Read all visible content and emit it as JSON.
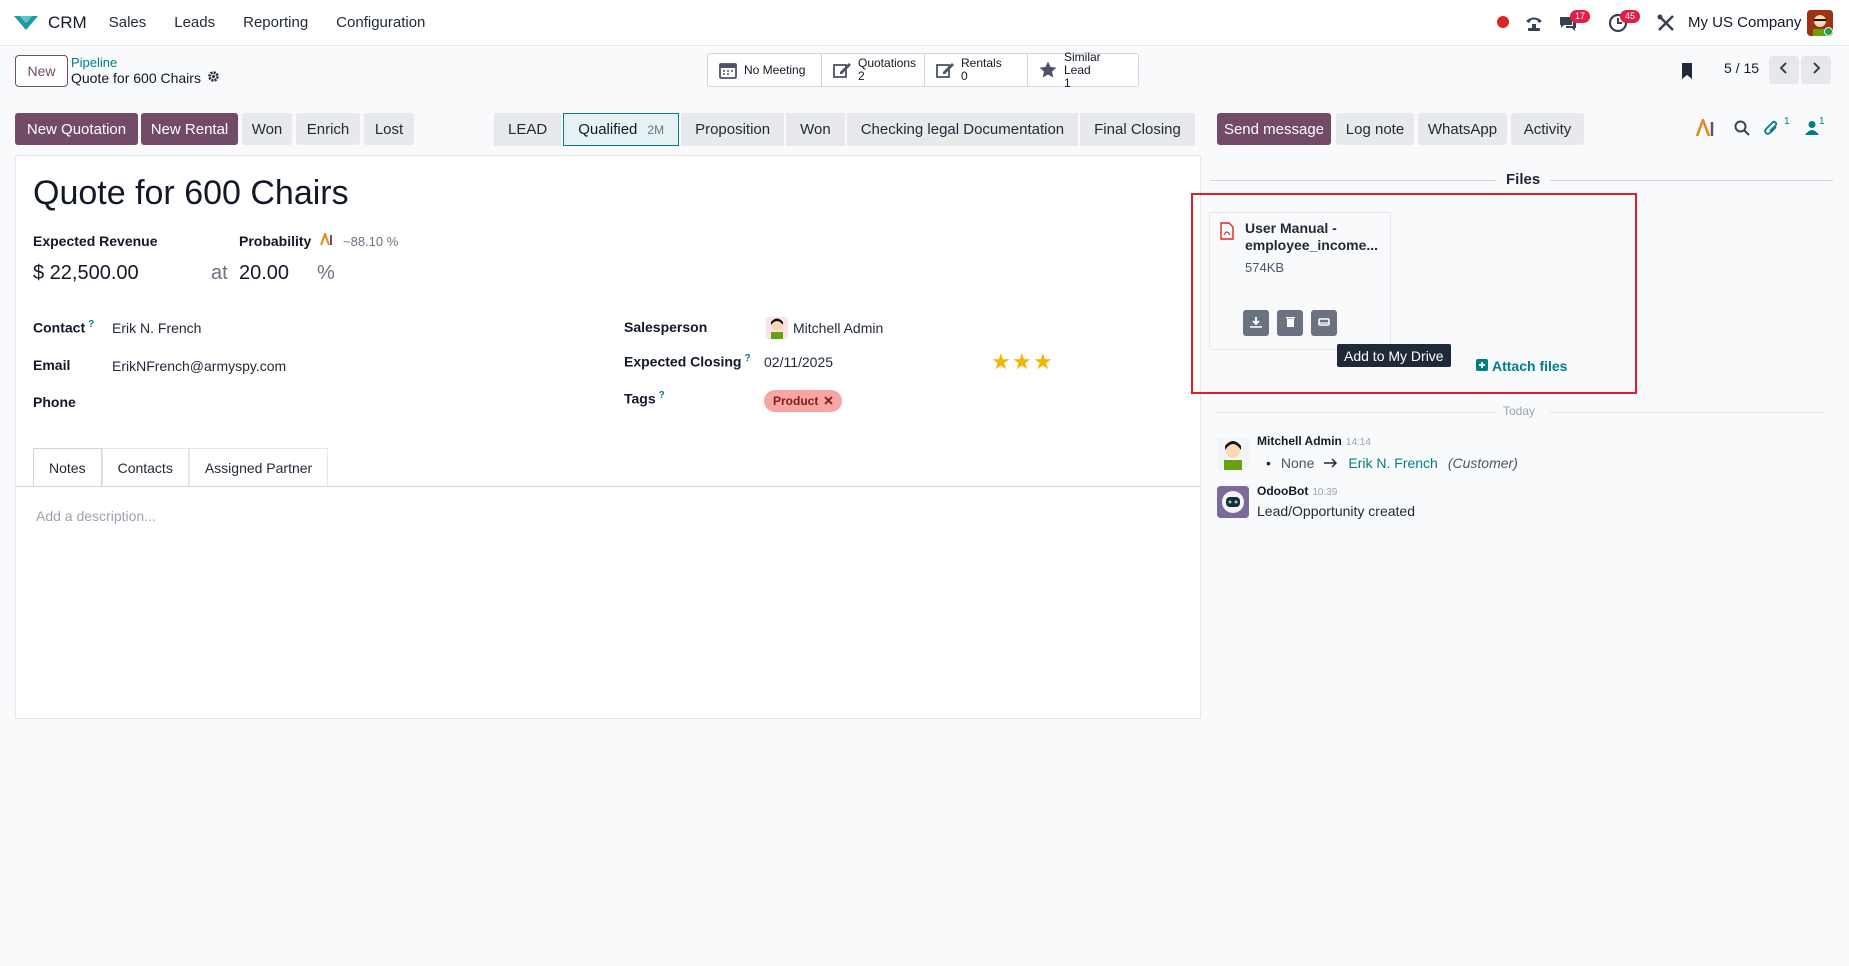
{
  "nav": {
    "app_name": "CRM",
    "menu": [
      "Sales",
      "Leads",
      "Reporting",
      "Configuration"
    ],
    "chat_badge": "17",
    "activity_badge": "45",
    "company": "My US Company"
  },
  "control": {
    "new_label": "New",
    "breadcrumb_parent": "Pipeline",
    "breadcrumb_current": "Quote for 600 Chairs",
    "smart_buttons": [
      {
        "label": "No Meeting",
        "value": ""
      },
      {
        "label": "Quotations",
        "value": "2"
      },
      {
        "label": "Rentals",
        "value": "0"
      },
      {
        "label": "Similar Lead",
        "value": "1"
      }
    ],
    "pager": "5 / 15"
  },
  "actions": {
    "new_quotation": "New Quotation",
    "new_rental": "New Rental",
    "won": "Won",
    "enrich": "Enrich",
    "lost": "Lost"
  },
  "stages": [
    {
      "label": "LEAD",
      "duration": ""
    },
    {
      "label": "Qualified",
      "duration": "2M"
    },
    {
      "label": "Proposition",
      "duration": ""
    },
    {
      "label": "Won",
      "duration": ""
    },
    {
      "label": "Checking legal Documentation",
      "duration": ""
    },
    {
      "label": "Final Closing",
      "duration": ""
    }
  ],
  "form": {
    "title": "Quote for 600 Chairs",
    "expected_revenue_label": "Expected Revenue",
    "expected_revenue": "$ 22,500.00",
    "at": "at",
    "probability_label": "Probability",
    "ai_probability": "~88.10 %",
    "probability": "20.00",
    "percent": "%",
    "contact_label": "Contact",
    "contact": "Erik N. French",
    "email_label": "Email",
    "email": "ErikNFrench@armyspy.com",
    "phone_label": "Phone",
    "salesperson_label": "Salesperson",
    "salesperson": "Mitchell Admin",
    "expected_closing_label": "Expected Closing",
    "expected_closing": "02/11/2025",
    "tags_label": "Tags",
    "tag": "Product",
    "priority_stars": 3,
    "help_mark": "?",
    "tabs": [
      "Notes",
      "Contacts",
      "Assigned Partner"
    ],
    "description_placeholder": "Add a description..."
  },
  "chatter": {
    "send_message": "Send message",
    "log_note": "Log note",
    "whatsapp": "WhatsApp",
    "activity": "Activity",
    "attachments_count": "1",
    "followers_count": "1",
    "files_title": "Files",
    "file_name_line1": "User Manual -",
    "file_name_line2": "employee_income...",
    "file_size": "574KB",
    "tooltip": "Add to My Drive",
    "attach_files": "Attach files",
    "today": "Today",
    "messages": [
      {
        "author": "Mitchell Admin",
        "time": "14:14",
        "from": "None",
        "to": "Erik N. French",
        "role": "(Customer)"
      },
      {
        "author": "OdooBot",
        "time": "10:39",
        "body": "Lead/Opportunity created"
      }
    ]
  },
  "colors": {
    "primary": "#714b67",
    "link": "#017e84",
    "highlight_border": "#e11d2a",
    "star": "#f5b400"
  }
}
